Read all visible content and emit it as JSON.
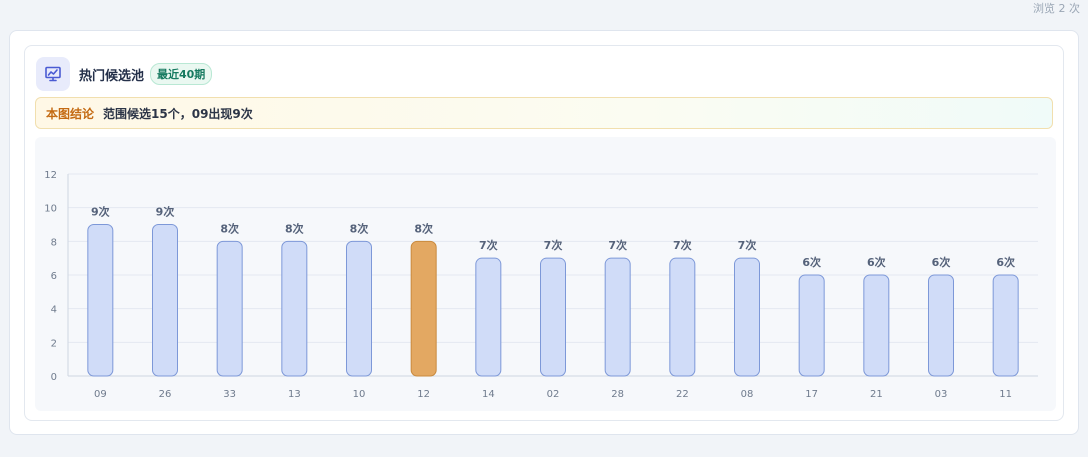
{
  "header": {
    "views_text": "浏览 2 次",
    "title": "热门候选池",
    "badge": "最近40期",
    "icon": "chart-presentation-icon"
  },
  "conclusion": {
    "label": "本图结论",
    "text": "范围候选15个，09出现9次"
  },
  "colors": {
    "bar_fill": "#d0dcf8",
    "bar_stroke": "#7d98d8",
    "highlight_fill": "#e3a862",
    "highlight_stroke": "#c98a3e",
    "accent": "#4a5bd3"
  },
  "chart_data": {
    "type": "bar",
    "title": "",
    "xlabel": "",
    "ylabel": "",
    "categories": [
      "09",
      "26",
      "33",
      "13",
      "10",
      "12",
      "14",
      "02",
      "28",
      "22",
      "08",
      "17",
      "21",
      "03",
      "11"
    ],
    "values": [
      9,
      9,
      8,
      8,
      8,
      8,
      7,
      7,
      7,
      7,
      7,
      6,
      6,
      6,
      6
    ],
    "data_labels": [
      "9次",
      "9次",
      "8次",
      "8次",
      "8次",
      "8次",
      "7次",
      "7次",
      "7次",
      "7次",
      "7次",
      "6次",
      "6次",
      "6次",
      "6次"
    ],
    "highlight_category": "12",
    "ylim": [
      0,
      12
    ],
    "yticks": [
      0,
      2,
      4,
      6,
      8,
      10,
      12
    ],
    "grid": true,
    "legend": "none"
  }
}
